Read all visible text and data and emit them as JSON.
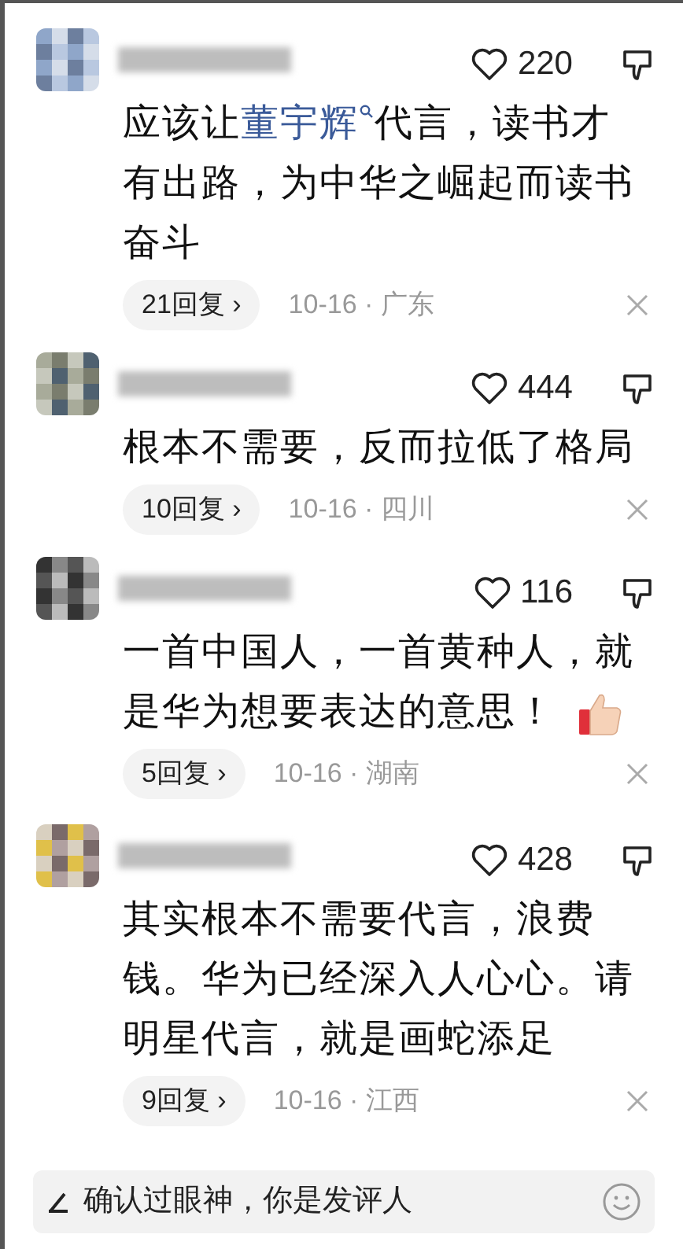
{
  "comments": [
    {
      "likes": "220",
      "liked": false,
      "text": [
        {
          "kind": "text",
          "text": "应该让"
        },
        {
          "kind": "link",
          "text": "董宇辉"
        },
        {
          "kind": "text",
          "text": "代言，读书才有出路，为中华之崛起而读书奋斗"
        }
      ],
      "replies": "21回复 ›",
      "meta": "10-16 · 广东"
    },
    {
      "likes": "444",
      "liked": false,
      "text": [
        {
          "kind": "text",
          "text": "根本不需要，反而拉低了格局"
        }
      ],
      "replies": "10回复 ›",
      "meta": "10-16 · 四川"
    },
    {
      "likes": "116",
      "liked": false,
      "text": [
        {
          "kind": "text",
          "text": "一首中国人，一首黄种人，就是华为想要表达的意思！"
        },
        {
          "kind": "thumbs_up"
        }
      ],
      "replies": "5回复 ›",
      "meta": "10-16 · 湖南"
    },
    {
      "likes": "428",
      "liked": false,
      "text": [
        {
          "kind": "text",
          "text": "其实根本不需要代言，浪费钱。华为已经深入人心心。请明星代言，就是画蛇添足"
        }
      ],
      "replies": "9回复 ›",
      "meta": "10-16 · 江西"
    }
  ],
  "comment_input": {
    "placeholder": "确认过眼神，你是发评人"
  }
}
